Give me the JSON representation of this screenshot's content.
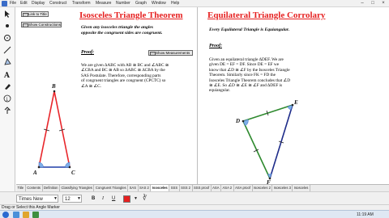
{
  "menu": [
    "File",
    "Edit",
    "Display",
    "Construct",
    "Transform",
    "Measure",
    "Number",
    "Graph",
    "Window",
    "Help"
  ],
  "buttons": {
    "link_to_title": "Link to Title",
    "show_constructions": "Show Constructions",
    "show_measurements": "Show Measurements"
  },
  "isosceles": {
    "title": "Isosceles Triangle Theorem",
    "statement": [
      "Given any isosceles triangle the angles",
      "opposite the congruent sides are congruent."
    ],
    "proof_label": "Proof:",
    "proof": [
      "We are given ∆ABC with AB ≅ BC and ∠ABC ≅",
      "∠CBA and BC ≅ AB so ∆ABC ≅ ∆CBA by the",
      "SAS Postulate.  Therefore, corresponding parts",
      "of congruent triangles are congruent (CPCTC) so",
      "∠A ≅ ∠C."
    ],
    "labels": {
      "B": "B",
      "A": "A",
      "C": "C"
    }
  },
  "equilateral": {
    "title": "Equilateral Triangle Corrolary",
    "statement": "Every Equilateral Triangle is Equiangular.",
    "proof_label": "Proof:",
    "proof": [
      "Given an equilateral triangle  ∆DEF. We are",
      "given DE = EF = DF.  Since DE = EF we",
      "know that ∠D ≅ ∠F by the Isosceles Triangle",
      "Theorem.  Similarly since FK = FD the",
      "Isosceles Triangle Theorem concludes that ∠D",
      "≅ ∠E.  So ∠D ≅ ∠E ≅ ∠F and ∆DEF is",
      "equiangular."
    ],
    "labels": {
      "D": "D",
      "E": "E",
      "F": "F"
    }
  },
  "tabs": [
    "Title",
    "Contents",
    "Definition",
    "Classifying Triangles",
    "Congruent Triangles",
    "SAS",
    "SAS 2",
    "Isosceles",
    "SSS",
    "SSS 2",
    "SSS proof",
    "ASA",
    "ASA 2",
    "ASA proof",
    "Isosceles 2",
    "Isosceles 3",
    "Isosceles"
  ],
  "active_tab": "Isosceles",
  "format": {
    "font": "Times New Roman",
    "size": "12",
    "bold": "B",
    "italic": "I",
    "underline": "U"
  },
  "status": "Drag or Select this Angle Marker",
  "clock": "11:19 AM",
  "colors": {
    "title_red": "#e62020",
    "iso_sides": "#e8262b",
    "iso_base": "#1f3fa8",
    "eq_side1": "#2f8a2f",
    "eq_side2": "#1e2c8a"
  }
}
